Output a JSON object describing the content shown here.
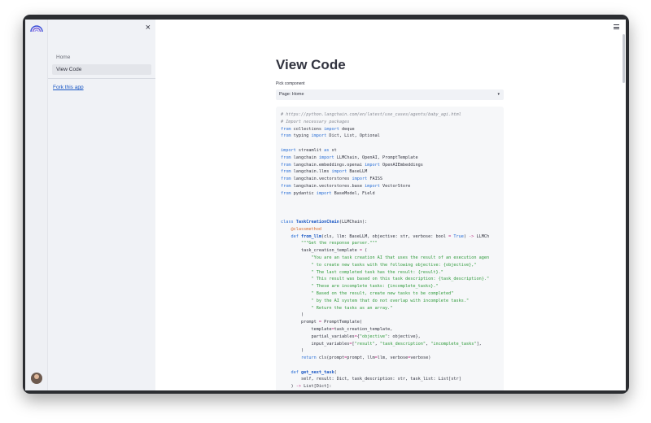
{
  "sidebar": {
    "close_label": "×",
    "nav": [
      {
        "label": "Home"
      },
      {
        "label": "View Code"
      }
    ],
    "fork_label": "Fork this app"
  },
  "main": {
    "title": "View Code",
    "select_label": "Pick component",
    "select_value": "Page: Home",
    "select_arrow": "▾"
  },
  "code": {
    "lines": [
      [
        {
          "t": "# https://python.langchain.com/en/latest/use_cases/agents/baby_agi.html",
          "c": "cm"
        }
      ],
      [
        {
          "t": "# Import necessary packages",
          "c": "cm"
        }
      ],
      [
        {
          "t": "from",
          "c": "kw"
        },
        {
          "t": " collections "
        },
        {
          "t": "import",
          "c": "kw"
        },
        {
          "t": " deque"
        }
      ],
      [
        {
          "t": "from",
          "c": "kw"
        },
        {
          "t": " typing "
        },
        {
          "t": "import",
          "c": "kw"
        },
        {
          "t": " Dict, List, Optional"
        }
      ],
      [],
      [
        {
          "t": "import",
          "c": "kw"
        },
        {
          "t": " streamlit "
        },
        {
          "t": "as",
          "c": "kw"
        },
        {
          "t": " st"
        }
      ],
      [
        {
          "t": "from",
          "c": "kw"
        },
        {
          "t": " langchain "
        },
        {
          "t": "import",
          "c": "kw"
        },
        {
          "t": " LLMChain, OpenAI, PromptTemplate"
        }
      ],
      [
        {
          "t": "from",
          "c": "kw"
        },
        {
          "t": " langchain.embeddings.openai "
        },
        {
          "t": "import",
          "c": "kw"
        },
        {
          "t": " OpenAIEmbeddings"
        }
      ],
      [
        {
          "t": "from",
          "c": "kw"
        },
        {
          "t": " langchain.llms "
        },
        {
          "t": "import",
          "c": "kw"
        },
        {
          "t": " BaseLLM"
        }
      ],
      [
        {
          "t": "from",
          "c": "kw"
        },
        {
          "t": " langchain.vectorstores "
        },
        {
          "t": "import",
          "c": "kw"
        },
        {
          "t": " FAISS"
        }
      ],
      [
        {
          "t": "from",
          "c": "kw"
        },
        {
          "t": " langchain.vectorstores.base "
        },
        {
          "t": "import",
          "c": "kw"
        },
        {
          "t": " VectorStore"
        }
      ],
      [
        {
          "t": "from",
          "c": "kw"
        },
        {
          "t": " pydantic "
        },
        {
          "t": "import",
          "c": "kw"
        },
        {
          "t": " BaseModel, Field"
        }
      ],
      [],
      [],
      [],
      [
        {
          "t": "class",
          "c": "kw"
        },
        {
          "t": " "
        },
        {
          "t": "TaskCreationChain",
          "c": "fn"
        },
        {
          "t": "(LLMChain):"
        }
      ],
      [
        {
          "t": "    "
        },
        {
          "t": "@classmethod",
          "c": "dc"
        }
      ],
      [
        {
          "t": "    "
        },
        {
          "t": "def",
          "c": "kw"
        },
        {
          "t": " "
        },
        {
          "t": "from_llm",
          "c": "fn"
        },
        {
          "t": "(cls, llm: BaseLLM, objective: str, verbose: bool "
        },
        {
          "t": "=",
          "c": "op"
        },
        {
          "t": " "
        },
        {
          "t": "True",
          "c": "kw"
        },
        {
          "t": ") "
        },
        {
          "t": "->",
          "c": "op"
        },
        {
          "t": " LLMCh"
        }
      ],
      [
        {
          "t": "        "
        },
        {
          "t": "\"\"\"Get the response parser.\"\"\"",
          "c": "st"
        }
      ],
      [
        {
          "t": "        task_creation_template "
        },
        {
          "t": "=",
          "c": "op"
        },
        {
          "t": " ("
        }
      ],
      [
        {
          "t": "            "
        },
        {
          "t": "\"You are an task creation AI that uses the result of an execution agen",
          "c": "st"
        }
      ],
      [
        {
          "t": "            "
        },
        {
          "t": "\" to create new tasks with the following objective: {objective},\"",
          "c": "st"
        }
      ],
      [
        {
          "t": "            "
        },
        {
          "t": "\" The last completed task has the result: {result}.\"",
          "c": "st"
        }
      ],
      [
        {
          "t": "            "
        },
        {
          "t": "\" This result was based on this task description: {task_description}.\"",
          "c": "st"
        }
      ],
      [
        {
          "t": "            "
        },
        {
          "t": "\" These are incomplete tasks: {incomplete_tasks}.\"",
          "c": "st"
        }
      ],
      [
        {
          "t": "            "
        },
        {
          "t": "\" Based on the result, create new tasks to be completed\"",
          "c": "st"
        }
      ],
      [
        {
          "t": "            "
        },
        {
          "t": "\" by the AI system that do not overlap with incomplete tasks.\"",
          "c": "st"
        }
      ],
      [
        {
          "t": "            "
        },
        {
          "t": "\" Return the tasks as an array.\"",
          "c": "st"
        }
      ],
      [
        {
          "t": "        )"
        }
      ],
      [
        {
          "t": "        prompt "
        },
        {
          "t": "=",
          "c": "op"
        },
        {
          "t": " PromptTemplate("
        }
      ],
      [
        {
          "t": "            template"
        },
        {
          "t": "=",
          "c": "op"
        },
        {
          "t": "task_creation_template,"
        }
      ],
      [
        {
          "t": "            partial_variables"
        },
        {
          "t": "=",
          "c": "op"
        },
        {
          "t": "{"
        },
        {
          "t": "\"objective\"",
          "c": "st"
        },
        {
          "t": ": objective},"
        }
      ],
      [
        {
          "t": "            input_variables"
        },
        {
          "t": "=",
          "c": "op"
        },
        {
          "t": "["
        },
        {
          "t": "\"result\"",
          "c": "st"
        },
        {
          "t": ", "
        },
        {
          "t": "\"task_description\"",
          "c": "st"
        },
        {
          "t": ", "
        },
        {
          "t": "\"incomplete_tasks\"",
          "c": "st"
        },
        {
          "t": "],"
        }
      ],
      [
        {
          "t": "        )"
        }
      ],
      [
        {
          "t": "        "
        },
        {
          "t": "return",
          "c": "kw"
        },
        {
          "t": " cls(prompt"
        },
        {
          "t": "=",
          "c": "op"
        },
        {
          "t": "prompt, llm"
        },
        {
          "t": "=",
          "c": "op"
        },
        {
          "t": "llm, verbose"
        },
        {
          "t": "=",
          "c": "op"
        },
        {
          "t": "verbose)"
        }
      ],
      [],
      [
        {
          "t": "    "
        },
        {
          "t": "def",
          "c": "kw"
        },
        {
          "t": " "
        },
        {
          "t": "get_next_task",
          "c": "fn"
        },
        {
          "t": "("
        }
      ],
      [
        {
          "t": "        self, result: Dict, task_description: str, task_list: List[str]"
        }
      ],
      [
        {
          "t": "    ) "
        },
        {
          "t": "->",
          "c": "op"
        },
        {
          "t": " List[Dict]:"
        }
      ]
    ]
  }
}
